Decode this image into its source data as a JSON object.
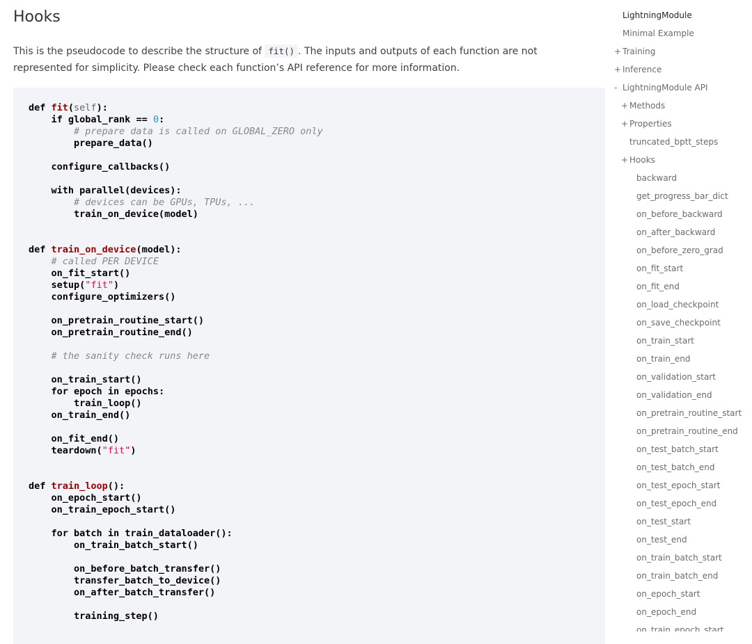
{
  "main": {
    "title": "Hooks",
    "intro_before": "This is the pseudocode to describe the structure of ",
    "intro_code": "fit()",
    "intro_after": ". The inputs and outputs of each function are not represented for simplicity. Please check each function’s API reference for more information.",
    "code_lines": [
      [
        {
          "t": "kw",
          "s": "def "
        },
        {
          "t": "fn",
          "s": "fit"
        },
        {
          "t": "p",
          "s": "("
        },
        {
          "t": "param",
          "s": "self"
        },
        {
          "t": "p",
          "s": "):"
        }
      ],
      [
        {
          "t": "p",
          "s": "    "
        },
        {
          "t": "kw",
          "s": "if"
        },
        {
          "t": "p",
          "s": " global_rank == "
        },
        {
          "t": "num",
          "s": "0"
        },
        {
          "t": "p",
          "s": ":"
        }
      ],
      [
        {
          "t": "p",
          "s": "        "
        },
        {
          "t": "cm",
          "s": "# prepare data is called on GLOBAL_ZERO only"
        }
      ],
      [
        {
          "t": "p",
          "s": "        prepare_data()"
        }
      ],
      [],
      [
        {
          "t": "p",
          "s": "    configure_callbacks()"
        }
      ],
      [],
      [
        {
          "t": "p",
          "s": "    "
        },
        {
          "t": "kw",
          "s": "with"
        },
        {
          "t": "p",
          "s": " parallel(devices):"
        }
      ],
      [
        {
          "t": "p",
          "s": "        "
        },
        {
          "t": "cm",
          "s": "# devices can be GPUs, TPUs, ..."
        }
      ],
      [
        {
          "t": "p",
          "s": "        train_on_device(model)"
        }
      ],
      [],
      [],
      [
        {
          "t": "kw",
          "s": "def "
        },
        {
          "t": "fn",
          "s": "train_on_device"
        },
        {
          "t": "p",
          "s": "(model):"
        }
      ],
      [
        {
          "t": "p",
          "s": "    "
        },
        {
          "t": "cm",
          "s": "# called PER DEVICE"
        }
      ],
      [
        {
          "t": "p",
          "s": "    on_fit_start()"
        }
      ],
      [
        {
          "t": "p",
          "s": "    setup("
        },
        {
          "t": "str",
          "s": "\"fit\""
        },
        {
          "t": "p",
          "s": ")"
        }
      ],
      [
        {
          "t": "p",
          "s": "    configure_optimizers()"
        }
      ],
      [],
      [
        {
          "t": "p",
          "s": "    on_pretrain_routine_start()"
        }
      ],
      [
        {
          "t": "p",
          "s": "    on_pretrain_routine_end()"
        }
      ],
      [],
      [
        {
          "t": "p",
          "s": "    "
        },
        {
          "t": "cm",
          "s": "# the sanity check runs here"
        }
      ],
      [],
      [
        {
          "t": "p",
          "s": "    on_train_start()"
        }
      ],
      [
        {
          "t": "p",
          "s": "    "
        },
        {
          "t": "kw",
          "s": "for"
        },
        {
          "t": "p",
          "s": " epoch "
        },
        {
          "t": "kw",
          "s": "in"
        },
        {
          "t": "p",
          "s": " epochs:"
        }
      ],
      [
        {
          "t": "p",
          "s": "        train_loop()"
        }
      ],
      [
        {
          "t": "p",
          "s": "    on_train_end()"
        }
      ],
      [],
      [
        {
          "t": "p",
          "s": "    on_fit_end()"
        }
      ],
      [
        {
          "t": "p",
          "s": "    teardown("
        },
        {
          "t": "str",
          "s": "\"fit\""
        },
        {
          "t": "p",
          "s": ")"
        }
      ],
      [],
      [],
      [
        {
          "t": "kw",
          "s": "def "
        },
        {
          "t": "fn",
          "s": "train_loop"
        },
        {
          "t": "p",
          "s": "():"
        }
      ],
      [
        {
          "t": "p",
          "s": "    on_epoch_start()"
        }
      ],
      [
        {
          "t": "p",
          "s": "    on_train_epoch_start()"
        }
      ],
      [],
      [
        {
          "t": "p",
          "s": "    "
        },
        {
          "t": "kw",
          "s": "for"
        },
        {
          "t": "p",
          "s": " batch "
        },
        {
          "t": "kw",
          "s": "in"
        },
        {
          "t": "p",
          "s": " train_dataloader():"
        }
      ],
      [
        {
          "t": "p",
          "s": "        on_train_batch_start()"
        }
      ],
      [],
      [
        {
          "t": "p",
          "s": "        on_before_batch_transfer()"
        }
      ],
      [
        {
          "t": "p",
          "s": "        transfer_batch_to_device()"
        }
      ],
      [
        {
          "t": "p",
          "s": "        on_after_batch_transfer()"
        }
      ],
      [],
      [
        {
          "t": "p",
          "s": "        training_step()"
        }
      ]
    ]
  },
  "sidebar": {
    "items": [
      {
        "label": "LightningModule",
        "level": 0,
        "toggle": "",
        "active": true
      },
      {
        "label": "Minimal Example",
        "level": 0,
        "toggle": ""
      },
      {
        "label": "Training",
        "level": 0,
        "toggle": "+"
      },
      {
        "label": "Inference",
        "level": 0,
        "toggle": "+"
      },
      {
        "label": "LightningModule API",
        "level": 0,
        "toggle": "-"
      },
      {
        "label": "Methods",
        "level": 1,
        "toggle": "+"
      },
      {
        "label": "Properties",
        "level": 1,
        "toggle": "+"
      },
      {
        "label": "truncated_bptt_steps",
        "level": 1,
        "toggle": ""
      },
      {
        "label": "Hooks",
        "level": 1,
        "toggle": "+"
      },
      {
        "label": "backward",
        "level": 2,
        "toggle": ""
      },
      {
        "label": "get_progress_bar_dict",
        "level": 2,
        "toggle": ""
      },
      {
        "label": "on_before_backward",
        "level": 2,
        "toggle": ""
      },
      {
        "label": "on_after_backward",
        "level": 2,
        "toggle": ""
      },
      {
        "label": "on_before_zero_grad",
        "level": 2,
        "toggle": ""
      },
      {
        "label": "on_fit_start",
        "level": 2,
        "toggle": ""
      },
      {
        "label": "on_fit_end",
        "level": 2,
        "toggle": ""
      },
      {
        "label": "on_load_checkpoint",
        "level": 2,
        "toggle": ""
      },
      {
        "label": "on_save_checkpoint",
        "level": 2,
        "toggle": ""
      },
      {
        "label": "on_train_start",
        "level": 2,
        "toggle": ""
      },
      {
        "label": "on_train_end",
        "level": 2,
        "toggle": ""
      },
      {
        "label": "on_validation_start",
        "level": 2,
        "toggle": ""
      },
      {
        "label": "on_validation_end",
        "level": 2,
        "toggle": ""
      },
      {
        "label": "on_pretrain_routine_start",
        "level": 2,
        "toggle": ""
      },
      {
        "label": "on_pretrain_routine_end",
        "level": 2,
        "toggle": ""
      },
      {
        "label": "on_test_batch_start",
        "level": 2,
        "toggle": ""
      },
      {
        "label": "on_test_batch_end",
        "level": 2,
        "toggle": ""
      },
      {
        "label": "on_test_epoch_start",
        "level": 2,
        "toggle": ""
      },
      {
        "label": "on_test_epoch_end",
        "level": 2,
        "toggle": ""
      },
      {
        "label": "on_test_start",
        "level": 2,
        "toggle": ""
      },
      {
        "label": "on_test_end",
        "level": 2,
        "toggle": ""
      },
      {
        "label": "on_train_batch_start",
        "level": 2,
        "toggle": ""
      },
      {
        "label": "on_train_batch_end",
        "level": 2,
        "toggle": ""
      },
      {
        "label": "on_epoch_start",
        "level": 2,
        "toggle": ""
      },
      {
        "label": "on_epoch_end",
        "level": 2,
        "toggle": ""
      },
      {
        "label": "on_train_epoch_start",
        "level": 2,
        "toggle": ""
      }
    ]
  }
}
